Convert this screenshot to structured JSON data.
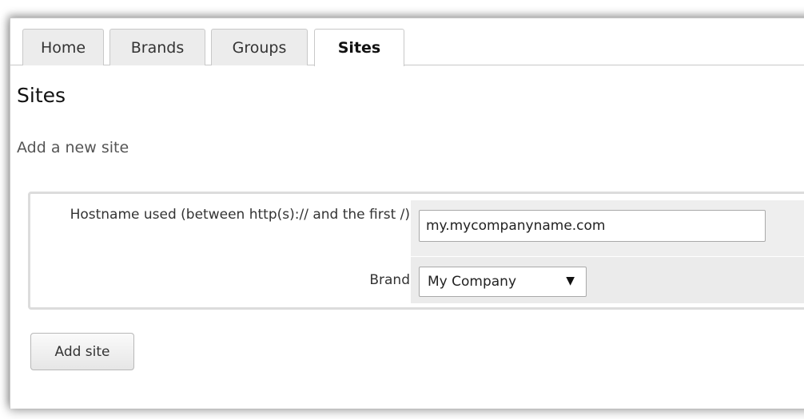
{
  "tabs": [
    {
      "label": "Home"
    },
    {
      "label": "Brands"
    },
    {
      "label": "Groups"
    },
    {
      "label": "Sites",
      "active": true
    }
  ],
  "page": {
    "title": "Sites",
    "subtitle": "Add a new site"
  },
  "form": {
    "hostname_label": "Hostname used (between http(s):// and the first /)",
    "hostname_value": "my.mycompanyname.com",
    "brand_label": "Brand",
    "brand_selected": "My Company",
    "brand_arrow": "▼"
  },
  "actions": {
    "add_site_label": "Add site"
  },
  "colors": {
    "tab_inactive_bg": "#ececec",
    "field_cell_bg": "#eeeeee",
    "border": "#c8c8c8"
  }
}
